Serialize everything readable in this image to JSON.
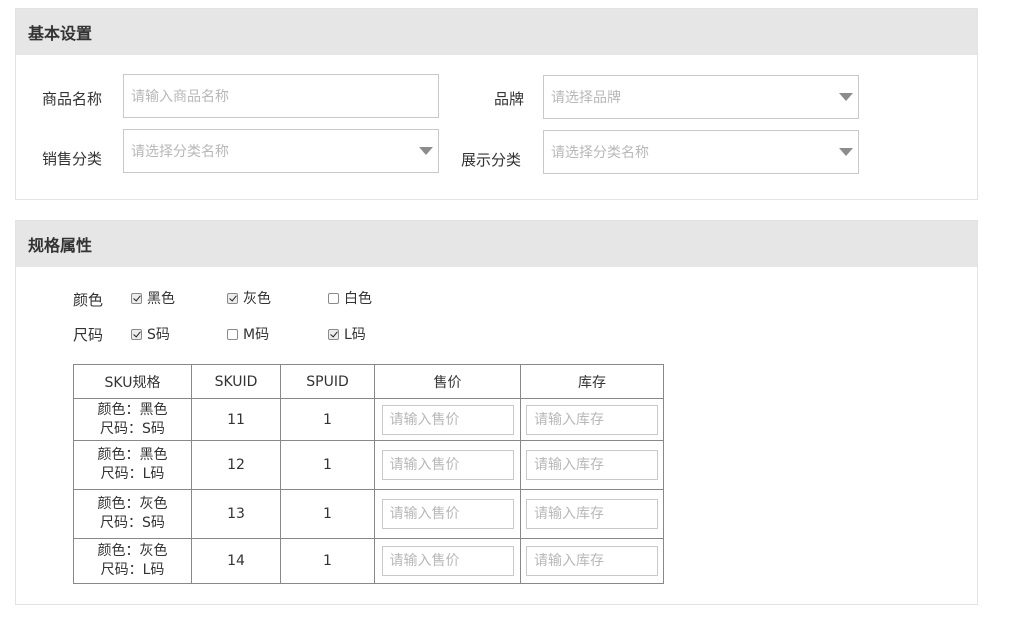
{
  "basic": {
    "title": "基本设置",
    "fields": {
      "product_name": {
        "label": "商品名称",
        "placeholder": "请输入商品名称"
      },
      "brand": {
        "label": "品牌",
        "placeholder": "请选择品牌"
      },
      "sales_category": {
        "label": "销售分类",
        "placeholder": "请选择分类名称"
      },
      "display_category": {
        "label": "展示分类",
        "placeholder": "请选择分类名称"
      }
    }
  },
  "spec": {
    "title": "规格属性",
    "color": {
      "label": "颜色",
      "options": [
        {
          "label": "黑色",
          "checked": true
        },
        {
          "label": "灰色",
          "checked": true
        },
        {
          "label": "白色",
          "checked": false
        }
      ]
    },
    "size": {
      "label": "尺码",
      "options": [
        {
          "label": "S码",
          "checked": true
        },
        {
          "label": "M码",
          "checked": false
        },
        {
          "label": "L码",
          "checked": true
        }
      ]
    },
    "table": {
      "headers": [
        "SKU规格",
        "SKUID",
        "SPUID",
        "售价",
        "库存"
      ],
      "price_placeholder": "请输入售价",
      "stock_placeholder": "请输入库存",
      "rows": [
        {
          "spec_line1": "颜色：黑色",
          "spec_line2": "尺码：S码",
          "skuid": "11",
          "spuid": "1"
        },
        {
          "spec_line1": "颜色：黑色",
          "spec_line2": "尺码：L码",
          "skuid": "12",
          "spuid": "1"
        },
        {
          "spec_line1": "颜色：灰色",
          "spec_line2": "尺码：S码",
          "skuid": "13",
          "spuid": "1"
        },
        {
          "spec_line1": "颜色：灰色",
          "spec_line2": "尺码：L码",
          "skuid": "14",
          "spuid": "1"
        }
      ]
    }
  }
}
